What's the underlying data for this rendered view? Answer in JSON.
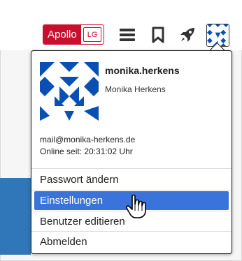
{
  "header": {
    "brand": "Apollo",
    "brand_badge": "LG",
    "icons": [
      "menu-icon",
      "bookmark-icon",
      "rocket-icon",
      "avatar-icon"
    ]
  },
  "profile": {
    "username": "monika.herkens",
    "full_name": "Monika Herkens",
    "email": "mail@monika-herkens.de",
    "online_status": "Online seit: 20:31:02 Uhr"
  },
  "menu": {
    "items": [
      {
        "label": "Passwort ändern"
      },
      {
        "label": "Einstellungen"
      },
      {
        "label": "Benutzer editieren"
      },
      {
        "label": "Abmelden"
      }
    ]
  },
  "colors": {
    "brand_red": "#c8102e",
    "highlight_blue": "#3a73d9",
    "avatar_blue": "#0a4fb3"
  }
}
